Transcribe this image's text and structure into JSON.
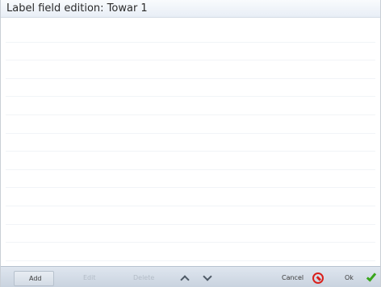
{
  "window": {
    "title": "Label field edition: Towar 1"
  },
  "list": {
    "rows": [
      "",
      "",
      "",
      "",
      "",
      "",
      "",
      "",
      "",
      "",
      "",
      "",
      ""
    ]
  },
  "toolbar": {
    "add_label": "Add",
    "edit_label": "Edit",
    "delete_label": "Delete",
    "up_icon": "chevron-up-icon",
    "down_icon": "chevron-down-icon",
    "cancel_label": "Cancel",
    "cancel_icon": "no-entry-icon",
    "ok_label": "Ok",
    "ok_icon": "checkmark-icon"
  },
  "colors": {
    "cancel_icon": "#d9201c",
    "ok_icon": "#3aa61e",
    "bottom_bar": "#cfd8e3"
  }
}
